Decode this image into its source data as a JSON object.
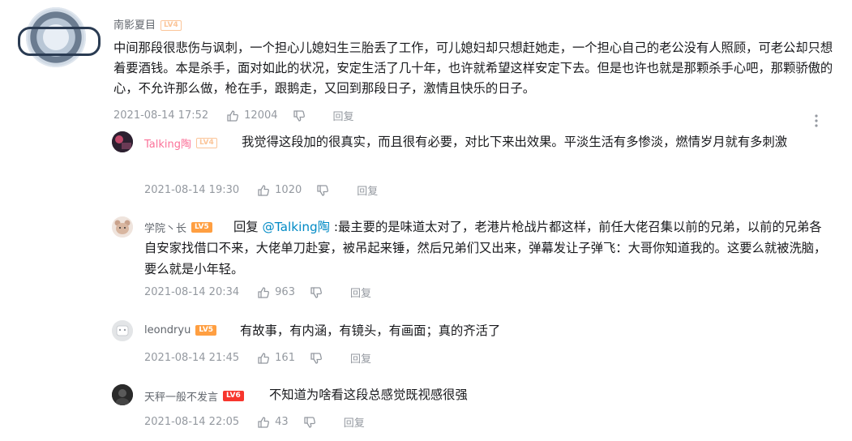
{
  "main": {
    "username": "南影夏目",
    "level": "LV4",
    "text": "中间那段很悲伤与讽刺，一个担心儿媳妇生三胎丢了工作，可儿媳妇却只想赶她走，一个担心自己的老公没有人照顾，可老公却只想着要酒钱。本是杀手，面对如此的状况，安定生活了几十年，也许就希望这样安定下去。但是也许也就是那颗杀手心吧，那颗骄傲的心，不允许那么做，枪在手，跟鹅走，又回到那段日子，激情且快乐的日子。",
    "time": "2021-08-14 17:52",
    "likes": "12004",
    "reply": "回复"
  },
  "replies": [
    {
      "username": "Talking陶",
      "level": "LV4",
      "text": "我觉得这段加的很真实，而且很有必要，对比下来出效果。平淡生活有多惨淡，燃情岁月就有多刺激",
      "time": "2021-08-14 19:30",
      "likes": "1020",
      "reply": "回复"
    },
    {
      "username": "学院丶长",
      "level": "LV5",
      "reply_prefix": "回复",
      "mention": "@Talking陶",
      "text": ":最主要的是味道太对了，老港片枪战片都这样，前任大佬召集以前的兄弟，以前的兄弟各自安家找借口不来，大佬单刀赴宴，被吊起来锤，然后兄弟们又出来，弹幕发让子弹飞：大哥你知道我的。这要么就被洗脑，要么就是小年轻。",
      "time": "2021-08-14 20:34",
      "likes": "963",
      "reply": "回复"
    },
    {
      "username": "leondryu",
      "level": "LV5",
      "text": "有故事，有内涵，有镜头，有画面；真的齐活了",
      "time": "2021-08-14 21:45",
      "likes": "161",
      "reply": "回复"
    },
    {
      "username": "天秤一般不发言",
      "level": "LV6",
      "text": "不知道为啥看这段总感觉既视感很强",
      "time": "2021-08-14 22:05",
      "likes": "43",
      "reply": "回复"
    }
  ],
  "colors": {
    "username_default": "#61666d",
    "username_vip": "#fb7299",
    "meta_gray": "#9499a0",
    "mention_blue": "#008ac5",
    "text": "#18191c"
  },
  "icons": [
    "thumbs-up-icon",
    "thumbs-down-icon",
    "more-vertical-icon"
  ]
}
